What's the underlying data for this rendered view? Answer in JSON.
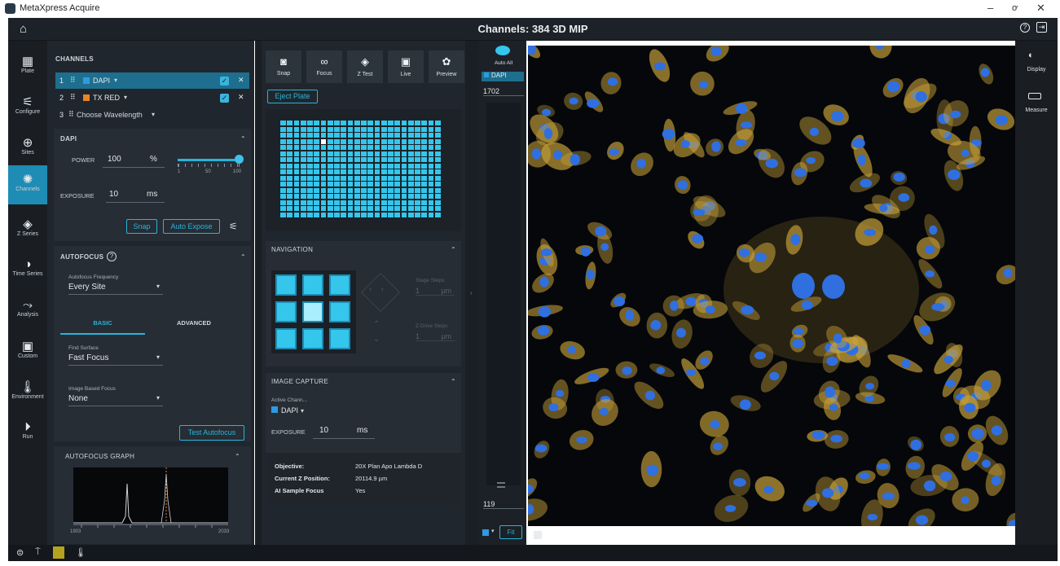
{
  "window": {
    "title": "MetaXpress Acquire",
    "minimize": "–",
    "maximize": "ơ",
    "close": "✕"
  },
  "header": {
    "title": "Channels: 384 3D MIP",
    "help_icon": "?",
    "exit_icon": "⇥",
    "home_icon": "⌂"
  },
  "nav": [
    {
      "label": "Plate",
      "icon": "plate-icon"
    },
    {
      "label": "Configure",
      "icon": "sliders-icon"
    },
    {
      "label": "Sites",
      "icon": "sites-icon"
    },
    {
      "label": "Channels",
      "icon": "channels-icon"
    },
    {
      "label": "Z Series",
      "icon": "layers-icon"
    },
    {
      "label": "Time Series",
      "icon": "clock-icon"
    },
    {
      "label": "Analysis",
      "icon": "analysis-icon"
    },
    {
      "label": "Custom",
      "icon": "book-icon"
    },
    {
      "label": "Environment",
      "icon": "thermometer-icon"
    },
    {
      "label": "Run",
      "icon": "play-icon"
    }
  ],
  "channels": {
    "section_title": "CHANNELS",
    "rows": [
      {
        "index": "1",
        "name": "DAPI",
        "color": "#2f9ae0",
        "checked": "✓",
        "remove": "✕"
      },
      {
        "index": "2",
        "name": "TX RED",
        "color": "#e8842a",
        "checked": "✓",
        "remove": "✕"
      },
      {
        "index": "3",
        "name": "Choose Wavelength",
        "color": "",
        "checked": "",
        "remove": ""
      }
    ]
  },
  "dapi": {
    "title": "DAPI",
    "power_label": "POWER",
    "power_value": "100",
    "power_unit": "%",
    "slider_ticks": [
      "1",
      "50",
      "100"
    ],
    "slider_level": 1.0,
    "exposure_label": "EXPOSURE",
    "exposure_value": "10",
    "exposure_unit": "ms",
    "snap": "Snap",
    "auto_expose": "Auto Expose"
  },
  "autofocus": {
    "title": "AUTOFOCUS",
    "freq_label": "Autofocus Frequency",
    "freq_value": "Every Site",
    "tab_basic": "BASIC",
    "tab_advanced": "ADVANCED",
    "find_label": "Find Surface",
    "find_value": "Fast Focus",
    "image_label": "Image Based Focus",
    "image_value": "None",
    "test_button": "Test Autofocus",
    "graph_title": "AUTOFOCUS GRAPH",
    "graph_xmin": "1903",
    "graph_xmax": "2033"
  },
  "toolbar": {
    "snap": "Snap",
    "focus": "Focus",
    "ztest": "Z Test",
    "live": "Live",
    "preview": "Preview"
  },
  "plate": {
    "eject": "Eject Plate",
    "rows": 16,
    "cols": 24
  },
  "navigation": {
    "title": "NAVIGATION",
    "stage_label": "Stage Steps",
    "stage_value": "1",
    "stage_unit": "µm",
    "zdrive_label": "Z Drive Steps",
    "zdrive_value": "1",
    "zdrive_unit": "µm"
  },
  "capture": {
    "title": "IMAGE CAPTURE",
    "active_label": "Active Chann...",
    "active_value": "DAPI",
    "exposure_label": "EXPOSURE",
    "exposure_value": "10",
    "exposure_unit": "ms",
    "objective_label": "Objective:",
    "objective_value": "20X Plan Apo Lambda D",
    "z_label": "Current Z Position:",
    "z_value": "20114.9 µm",
    "ai_label": "AI Sample Focus",
    "ai_value": "Yes"
  },
  "strip": {
    "auto_all": "Auto All",
    "channel": "DAPI",
    "max_value": "1702",
    "min_value": "119",
    "fit": "Fit"
  },
  "right": {
    "display": "Display",
    "measure": "Measure"
  },
  "colors": {
    "accent": "#29b3d9",
    "well": "#35c6ec",
    "nucleus": "#2f6fe0",
    "cyto": "#c9a23a"
  }
}
